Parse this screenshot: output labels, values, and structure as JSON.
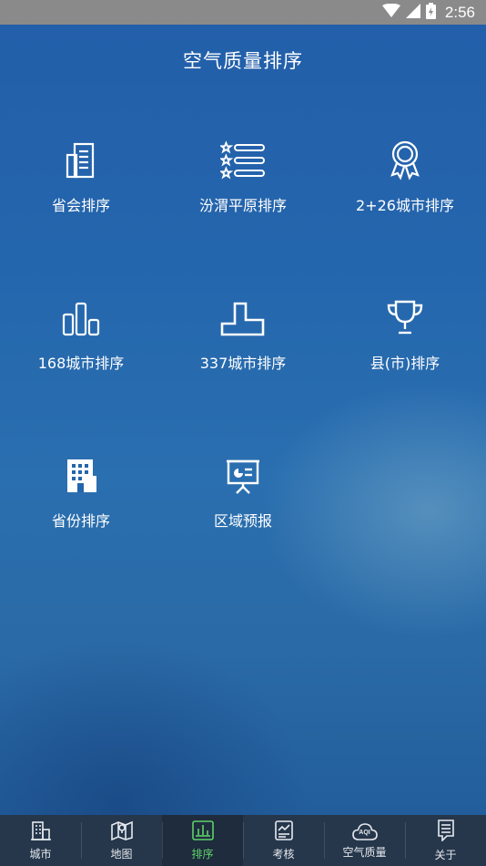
{
  "status_bar": {
    "time": "2:56"
  },
  "header": {
    "title": "空气质量排序"
  },
  "menu": [
    {
      "label": "省会排序",
      "icon": "building-icon"
    },
    {
      "label": "汾渭平原排序",
      "icon": "star-list-icon"
    },
    {
      "label": "2+26城市排序",
      "icon": "award-ribbon-icon"
    },
    {
      "label": "168城市排序",
      "icon": "bar-chart-icon"
    },
    {
      "label": "337城市排序",
      "icon": "step-chart-icon"
    },
    {
      "label": "县(市)排序",
      "icon": "trophy-icon"
    },
    {
      "label": "省份排序",
      "icon": "office-tower-icon"
    },
    {
      "label": "区域预报",
      "icon": "presentation-board-icon"
    }
  ],
  "tabs": [
    {
      "label": "城市",
      "icon": "city-icon",
      "active": false
    },
    {
      "label": "地图",
      "icon": "map-icon",
      "active": false
    },
    {
      "label": "排序",
      "icon": "ranking-icon",
      "active": true
    },
    {
      "label": "考核",
      "icon": "assessment-icon",
      "active": false
    },
    {
      "label": "空气质量",
      "icon": "aqi-cloud-icon",
      "active": false,
      "badge": "AQI"
    },
    {
      "label": "关于",
      "icon": "about-icon",
      "active": false
    }
  ],
  "colors": {
    "active_tab": "#5fd16a",
    "tabbar": "#26374c",
    "status_bar": "#8a8a8a"
  }
}
